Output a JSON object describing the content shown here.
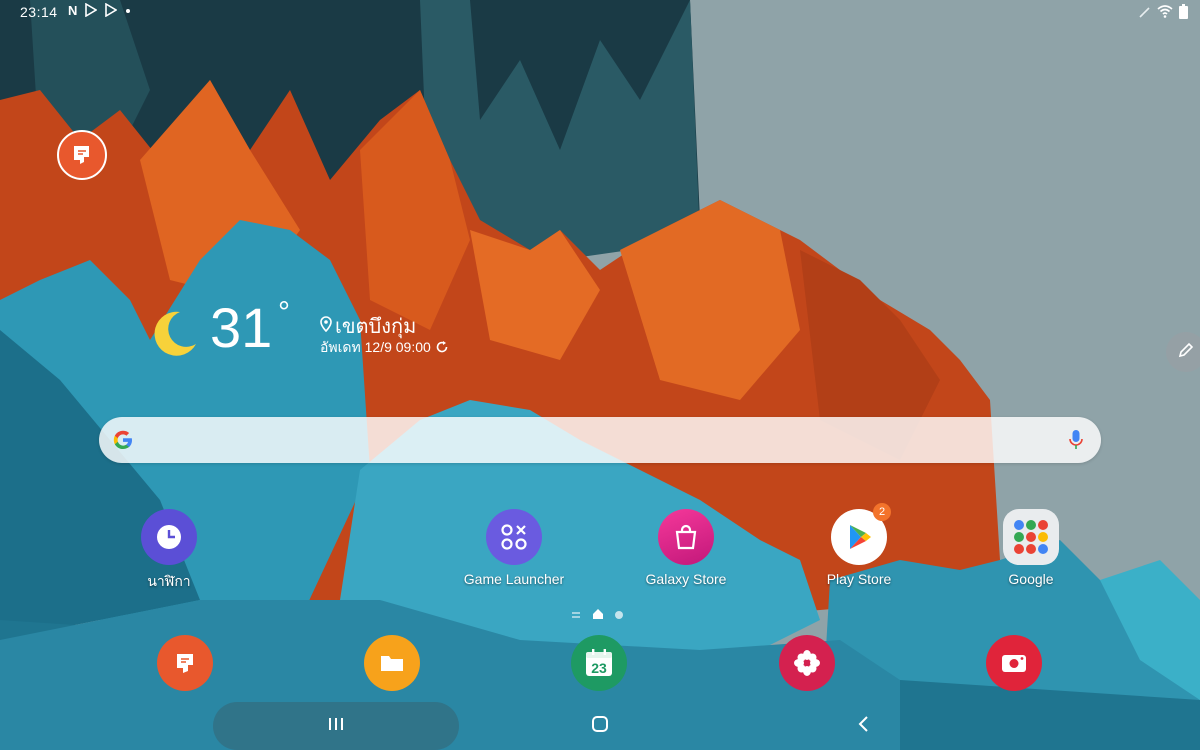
{
  "status_bar": {
    "time": "23:14",
    "left_icons": [
      "netflix-icon",
      "play-icon",
      "play-icon",
      "dot-icon"
    ],
    "right_icons": [
      "pen-icon",
      "wifi-icon",
      "battery-icon"
    ]
  },
  "weather": {
    "temperature": "31",
    "degree_symbol": "°",
    "location": "เขตบึงกุ่ม",
    "updated": "อัพเดท 12/9 09:00"
  },
  "search": {
    "placeholder": "",
    "icon": "google-g-icon",
    "mic_icon": "mic-icon"
  },
  "apps": [
    {
      "label": "นาฬิกา",
      "icon": "clock-icon",
      "color": "#5b4fd6"
    },
    {
      "label": "Game Launcher",
      "icon": "game-launcher-icon",
      "color": "#6a5be0"
    },
    {
      "label": "Galaxy Store",
      "icon": "shopping-bag-icon",
      "color": "#d2297f"
    },
    {
      "label": "Play Store",
      "icon": "play-store-icon",
      "color": "#ffffff",
      "badge": "2"
    },
    {
      "label": "Google",
      "icon": "google-folder-icon",
      "color": "#e9ecee"
    }
  ],
  "dock": [
    {
      "icon": "notes-icon",
      "color": "#e8582d"
    },
    {
      "icon": "folder-icon",
      "color": "#f7a21b"
    },
    {
      "icon": "calendar-icon",
      "color": "#1e9a63",
      "text": "23"
    },
    {
      "icon": "gallery-flower-icon",
      "color": "#d4214f"
    },
    {
      "icon": "screen-recorder-icon",
      "color": "#e0243a"
    }
  ],
  "page_indicator": {
    "pages": 3,
    "current": 2
  },
  "nav": {
    "recents": "recents-icon",
    "home": "home-icon",
    "back": "back-icon"
  }
}
